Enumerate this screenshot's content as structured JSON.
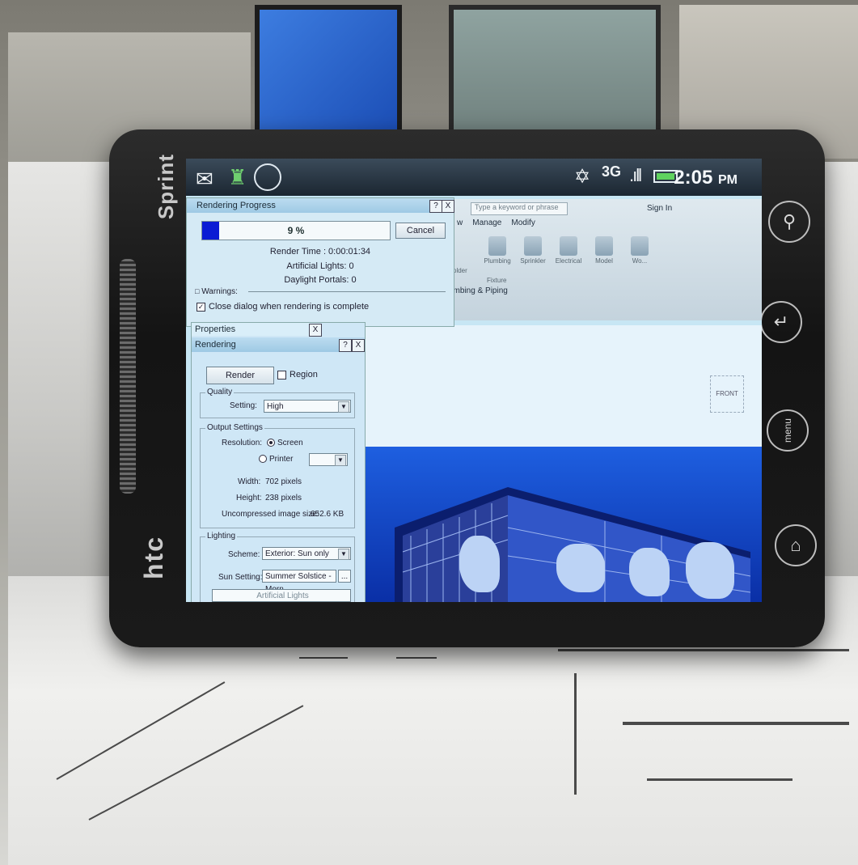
{
  "brand": {
    "carrier": "Sprint",
    "maker": "htc"
  },
  "status_bar": {
    "network": "3G",
    "time": "2:05",
    "ampm": "PM",
    "icons": [
      "mail-icon",
      "castle-app-icon",
      "globe-app-icon",
      "gps-icon",
      "signal-icon",
      "battery-icon"
    ]
  },
  "hardware_buttons": {
    "search": "search-icon",
    "back": "back-icon",
    "menu": "menu",
    "home": "home-icon"
  },
  "revit": {
    "search_placeholder": "Type a keyword or phrase",
    "sign_in": "Sign In",
    "tabs": [
      "w",
      "Manage",
      "Modify"
    ],
    "tools": [
      "Plumbing",
      "Sprinkler",
      "Electrical",
      "Model",
      "Wo..."
    ],
    "fixture": "Fixture",
    "older": "older",
    "panel_label": "umbing & Piping"
  },
  "progress_dialog": {
    "title": "Rendering Progress",
    "help": "?",
    "close": "X",
    "percent_label": "9 %",
    "progress": 0.09,
    "cancel": "Cancel",
    "render_time": "Render Time : 0:00:01:34",
    "artificial_lights": "Artificial Lights: 0",
    "daylight_portals": "Daylight Portals: 0",
    "warnings": "Warnings:",
    "close_when_complete": "Close dialog when rendering is complete"
  },
  "properties": {
    "title": "Properties",
    "close": "X",
    "dialog_title": "Rendering",
    "help": "?",
    "dlg_close": "X",
    "render_button": "Render",
    "region": "Region",
    "quality": {
      "label": "Quality",
      "setting_label": "Setting:",
      "setting_value": "High"
    },
    "output": {
      "label": "Output Settings",
      "resolution_label": "Resolution:",
      "screen": "Screen",
      "printer": "Printer",
      "width": "Width:",
      "width_value": "702 pixels",
      "height": "Height:",
      "height_value": "238 pixels",
      "size": "Uncompressed image size:",
      "size_value": "652.6 KB"
    },
    "lighting": {
      "label": "Lighting",
      "scheme_label": "Scheme:",
      "scheme_value": "Exterior: Sun only",
      "sun_label": "Sun Setting:",
      "sun_value": "Summer Solstice - Morn",
      "more": "...",
      "artificial": "Artificial Lights"
    }
  },
  "viewcube_label": "FRONT",
  "colors": {
    "progress_fill": "#0b1bd4",
    "render_sky": "#1e5fe0",
    "screen_bg": "#c7e6f4"
  }
}
